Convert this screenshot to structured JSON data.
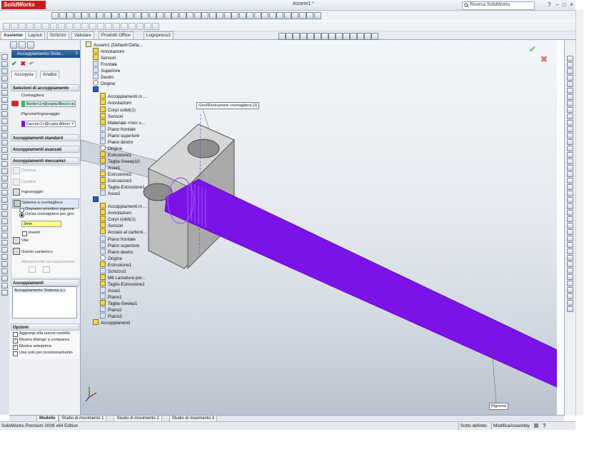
{
  "app": {
    "name": "SolidWorks",
    "document_title": "Assem1 *",
    "search_placeholder": "Ricerca SolidWorks",
    "colors": {
      "accent": "#1d4d87",
      "brand": "#c71c1c",
      "rack": "#7b12e8",
      "part": "#cfcfcf"
    }
  },
  "command_tabs": [
    "Assieme",
    "Layout",
    "Schizzo",
    "Valutare",
    "Prodotti Office",
    "Logopress3"
  ],
  "active_command_tab": "Assieme",
  "property_manager": {
    "title": "Accoppiamento Siste...",
    "help": "?",
    "tabs": [
      "Accoppia",
      "Analisi"
    ],
    "selections": {
      "header": "Selezioni di accoppiamento",
      "rack_label": "Cremagliera",
      "rack_value": "Bordo<1>@copia Blocco sc",
      "pinion_label": "Pignone/Ingranaggio",
      "pinion_value": "Faccia<1>@copia Albero Y"
    },
    "standard_header": "Accoppiamenti standard",
    "advanced_header": "Accoppiamenti avanzati",
    "mechanical": {
      "header": "Accoppiamenti meccanici",
      "items": [
        "Camma",
        "Cardine",
        "Ingranaggio",
        "Sistema a cremagliera"
      ],
      "radio1": "Diametro primitivo pignone",
      "radio2": "Corsa cremagliera per giro",
      "value": "3mm",
      "invert": "Inverti",
      "screw": "Vite",
      "universal": "Giunto cardanico",
      "alignment": "Allineamento accoppiamento:"
    },
    "mates": {
      "header": "Accoppiamenti",
      "item": "Accoppiamento Sistema a c"
    },
    "options": {
      "header": "Opzioni",
      "items": [
        {
          "label": "Aggiungi alla nuova cartella",
          "checked": false
        },
        {
          "label": "Mostra dialogo a comparsa",
          "checked": true
        },
        {
          "label": "Mostra anteprima",
          "checked": true
        },
        {
          "label": "Usa solo per posizionamento",
          "checked": false
        }
      ]
    }
  },
  "tree": [
    {
      "label": "Assem1  (Default<Defa...",
      "indent": 0,
      "icon": "assembly"
    },
    {
      "label": "Annotazioni",
      "indent": 1,
      "icon": "feat"
    },
    {
      "label": "Sensori",
      "indent": 1,
      "icon": "feat"
    },
    {
      "label": "Frontale",
      "indent": 1,
      "icon": "plane"
    },
    {
      "label": "Superiore",
      "indent": 1,
      "icon": "plane"
    },
    {
      "label": "Destro",
      "indent": 1,
      "icon": "plane"
    },
    {
      "label": "Origine",
      "indent": 1,
      "icon": "org"
    },
    {
      "label": "",
      "indent": 1,
      "icon": "part"
    },
    {
      "label": "Accoppiamenti in ...",
      "indent": 2,
      "icon": "feat"
    },
    {
      "label": "Annotazioni",
      "indent": 2,
      "icon": "feat"
    },
    {
      "label": "Corpi solidi(1)",
      "indent": 2,
      "icon": "feat"
    },
    {
      "label": "Sensori",
      "indent": 2,
      "icon": "feat"
    },
    {
      "label": "Materiale <non s...",
      "indent": 2,
      "icon": "feat"
    },
    {
      "label": "Piano frontale",
      "indent": 2,
      "icon": "plane"
    },
    {
      "label": "Piano superiore",
      "indent": 2,
      "icon": "plane"
    },
    {
      "label": "Piano destro",
      "indent": 2,
      "icon": "plane"
    },
    {
      "label": "Origine",
      "indent": 2,
      "icon": "org"
    },
    {
      "label": "Estrusione1",
      "indent": 2,
      "icon": "feat"
    },
    {
      "label": "Taglia-Sweep10",
      "indent": 2,
      "icon": "feat"
    },
    {
      "label": "Asse1",
      "indent": 2,
      "icon": "plane"
    },
    {
      "label": "Estrusione2",
      "indent": 2,
      "icon": "feat"
    },
    {
      "label": "Estrusione3",
      "indent": 2,
      "icon": "feat"
    },
    {
      "label": "Taglia-Estrusione1",
      "indent": 2,
      "icon": "feat"
    },
    {
      "label": "Asse2",
      "indent": 2,
      "icon": "plane"
    },
    {
      "label": "",
      "indent": 1,
      "icon": "part"
    },
    {
      "label": "Accoppiamenti in ...",
      "indent": 2,
      "icon": "feat"
    },
    {
      "label": "Annotazioni",
      "indent": 2,
      "icon": "feat"
    },
    {
      "label": "Corpi solidi(1)",
      "indent": 2,
      "icon": "feat"
    },
    {
      "label": "Sensori",
      "indent": 2,
      "icon": "feat"
    },
    {
      "label": "Acciaio al carboni...",
      "indent": 2,
      "icon": "feat"
    },
    {
      "label": "Piano frontale",
      "indent": 2,
      "icon": "plane"
    },
    {
      "label": "Piano superiore",
      "indent": 2,
      "icon": "plane"
    },
    {
      "label": "Piano destro",
      "indent": 2,
      "icon": "plane"
    },
    {
      "label": "Origine",
      "indent": 2,
      "icon": "org"
    },
    {
      "label": "Estrusione1",
      "indent": 2,
      "icon": "feat"
    },
    {
      "label": "Schizzo2",
      "indent": 2,
      "icon": "plane"
    },
    {
      "label": "M6 Lamatura per...",
      "indent": 2,
      "icon": "feat"
    },
    {
      "label": "Taglio-Estrusione1",
      "indent": 2,
      "icon": "feat"
    },
    {
      "label": "Asse1",
      "indent": 2,
      "icon": "plane"
    },
    {
      "label": "Piano1",
      "indent": 2,
      "icon": "plane"
    },
    {
      "label": "Taglia-Sweep1",
      "indent": 2,
      "icon": "feat"
    },
    {
      "label": "Piano2",
      "indent": 2,
      "icon": "plane"
    },
    {
      "label": "Piano3",
      "indent": 2,
      "icon": "plane"
    },
    {
      "label": "Accoppiamenti",
      "indent": 1,
      "icon": "feat"
    }
  ],
  "callouts": {
    "top": "Giro/Rivoluzione cremagliera [1]",
    "bottom": "Pignone"
  },
  "bottom_tabs": [
    "Modello",
    "Studio di movimento 1",
    "Studio di movimento 2",
    "Studio di movimento 3"
  ],
  "status": {
    "edition": "SolidWorks Premium 2009 x64 Edition",
    "state": "Sotto definito",
    "mode": "ModificaAssembly"
  }
}
